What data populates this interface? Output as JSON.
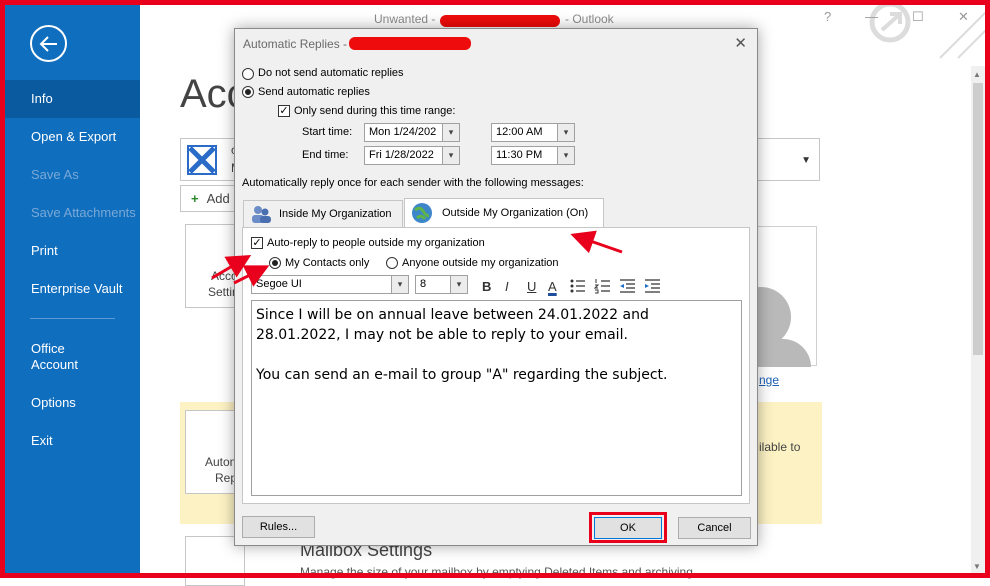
{
  "window": {
    "title_left": "Unwanted -",
    "title_right": "- Outlook",
    "minimize": "?",
    "help": "?"
  },
  "sidebar": {
    "items": [
      {
        "label": "Info"
      },
      {
        "label": "Open & Export"
      },
      {
        "label": "Save As"
      },
      {
        "label": "Save Attachments"
      },
      {
        "label": "Print"
      },
      {
        "label": "Enterprise Vault"
      },
      {
        "label": "Office Account"
      },
      {
        "label": "Options"
      },
      {
        "label": "Exit"
      }
    ]
  },
  "backstage": {
    "heading": "Acc",
    "account_line1": "o",
    "account_line2": "M",
    "add_account": "Add",
    "tile1_line1": "Acco",
    "tile1_line2": "Settin",
    "tile2_line1": "Autom",
    "tile2_line2": "Rep",
    "change_link": "nge",
    "available_text": "ilable to",
    "mailbox_title": "Mailbox Settings",
    "mailbox_sub": "Manage the size of your mailbox by emptying Deleted Items and archiving."
  },
  "dialog": {
    "title": "Automatic Replies -",
    "option_no_send": "Do not send automatic replies",
    "option_send": "Send automatic replies",
    "only_time_range": "Only send during this time range:",
    "start_time_label": "Start time:",
    "start_date": "Mon 1/24/202",
    "start_time": "12:00 AM",
    "end_time_label": "End time:",
    "end_date": "Fri 1/28/2022",
    "end_time": "11:30 PM",
    "reply_once": "Automatically reply once for each sender with the following messages:",
    "tab_inside": "Inside My Organization",
    "tab_outside": "Outside My Organization (On)",
    "auto_reply_outside": "Auto-reply to people outside my organization",
    "my_contacts_only": "My Contacts only",
    "anyone_outside": "Anyone outside my organization",
    "font_name": "Segoe UI",
    "font_size": "8",
    "bold": "B",
    "italic": "I",
    "underline": "U",
    "font_color": "A",
    "message_p1": "Since I will be on annual leave between 24.01.2022 and 28.01.2022, I may not be able to reply to your email.",
    "message_p2": "You can send an e-mail to group \"A\" regarding the subject.",
    "rules_button": "Rules...",
    "ok_button": "OK",
    "cancel_button": "Cancel"
  },
  "state": {
    "send_automatic_replies": true,
    "only_time_range_checked": true,
    "auto_reply_outside_checked": true,
    "my_contacts_only_selected": true
  },
  "colors": {
    "sidebar_bg": "#106ebe",
    "annotation_red": "#e8001c"
  }
}
